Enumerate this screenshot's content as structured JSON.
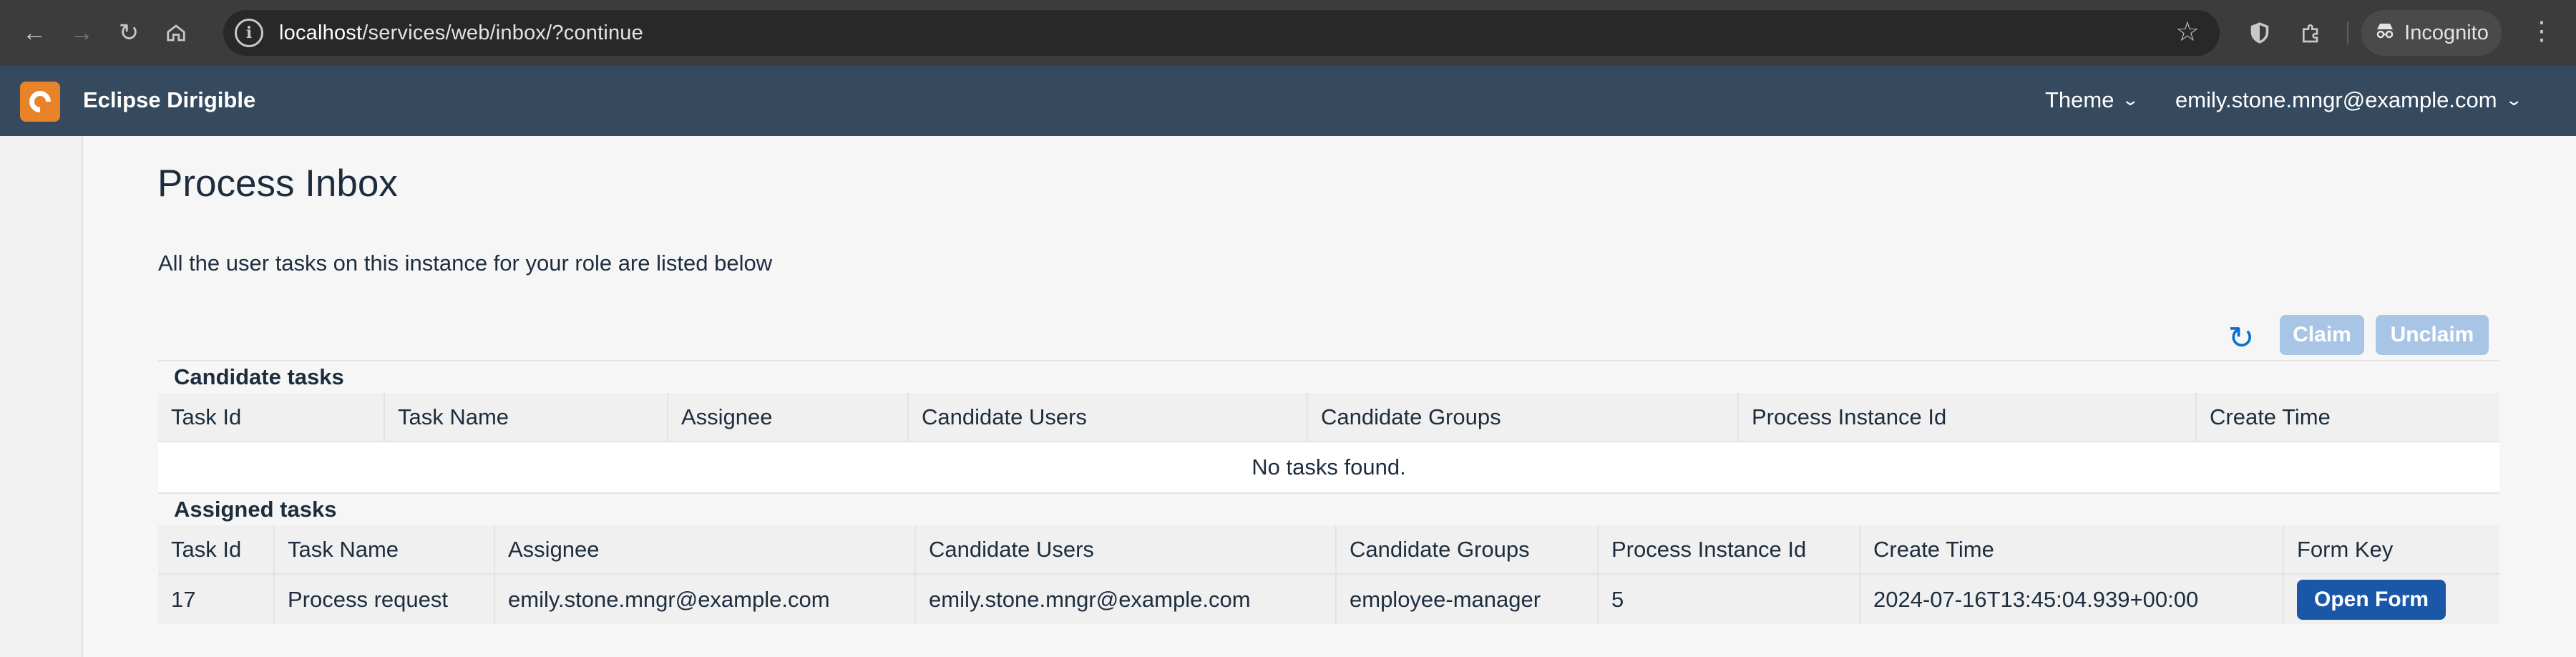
{
  "browser": {
    "url_host": "localhost",
    "url_path": "/services/web/inbox/?continue",
    "profile_label": "Incognito"
  },
  "shell": {
    "app_title": "Eclipse Dirigible",
    "theme_label": "Theme",
    "user_label": "emily.stone.mngr@example.com"
  },
  "page": {
    "title": "Process Inbox",
    "description": "All the user tasks on this instance for your role are listed below"
  },
  "toolbar": {
    "claim_label": "Claim",
    "unclaim_label": "Unclaim"
  },
  "candidate": {
    "title": "Candidate tasks",
    "columns": [
      "Task Id",
      "Task Name",
      "Assignee",
      "Candidate Users",
      "Candidate Groups",
      "Process Instance Id",
      "Create Time"
    ],
    "empty_text": "No tasks found."
  },
  "assigned": {
    "title": "Assigned tasks",
    "columns": [
      "Task Id",
      "Task Name",
      "Assignee",
      "Candidate Users",
      "Candidate Groups",
      "Process Instance Id",
      "Create Time",
      "Form Key"
    ],
    "rows": [
      {
        "task_id": "17",
        "task_name": "Process request",
        "assignee": "emily.stone.mngr@example.com",
        "candidate_users": "emily.stone.mngr@example.com",
        "candidate_groups": "employee-manager",
        "process_instance_id": "5",
        "create_time": "2024-07-16T13:45:04.939+00:00",
        "form_button_label": "Open Form"
      }
    ]
  },
  "colors": {
    "shell_bg": "#354a5f",
    "logo_bg": "#e8832a",
    "primary_button": "#1a57a9",
    "disabled_button": "#a9c5e6",
    "refresh_icon": "#0a6ed1"
  }
}
